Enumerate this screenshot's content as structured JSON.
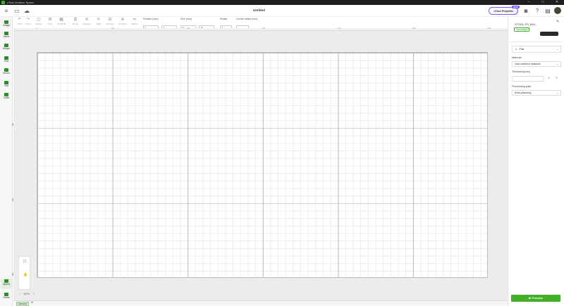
{
  "window": {
    "title": "xTool Creative Space",
    "controls": [
      "–",
      "□",
      "✕"
    ]
  },
  "header": {
    "doc_title": "Untitled",
    "projects_label": "xTool Projects",
    "projects_badge": "NEW"
  },
  "toolbar": {
    "undo": "Undo",
    "redo": "Redo",
    "outline": "Outline",
    "array": "Array",
    "smart_fill": "Smart fill",
    "group": "Group",
    "ungroup": "Ungroup",
    "align": "Align",
    "arrange": "Arrange",
    "combine": "Combine",
    "reflect": "Reflect",
    "position_label": "Position (mm)",
    "pos_x": "0",
    "pos_y": "0",
    "size_label": "Size (mm)",
    "size_w": "10",
    "size_h": "10",
    "rotate_label": "Rotate",
    "rotate_value": "0",
    "corner_label": "Corner radius (mm)",
    "corner_value": ""
  },
  "sidebar": {
    "items": [
      {
        "label": "Image"
      },
      {
        "label": "Insert"
      },
      {
        "label": "Shape"
      },
      {
        "label": "Text"
      },
      {
        "label": "Vector"
      },
      {
        "label": "Gift"
      },
      {
        "label": "Code"
      }
    ],
    "bottom": [
      {
        "label": "Speed"
      },
      {
        "label": "Home"
      }
    ]
  },
  "ruler": {
    "ticks": [
      "0",
      "100",
      "200",
      "300",
      "400",
      "500",
      "600"
    ]
  },
  "canvas": {
    "zoom": "101%",
    "tab_label": "Canvas1"
  },
  "right_panel": {
    "device_name": "XTOOL-P2_b2d...",
    "device_status": "Connected",
    "processing_type": "Flat",
    "material_label": "Material",
    "material_value": "User-defined material",
    "thickness_label": "Thickness(mm)",
    "path_label": "Processing path",
    "path_value": "Auto-planning",
    "process_button": "Process"
  }
}
